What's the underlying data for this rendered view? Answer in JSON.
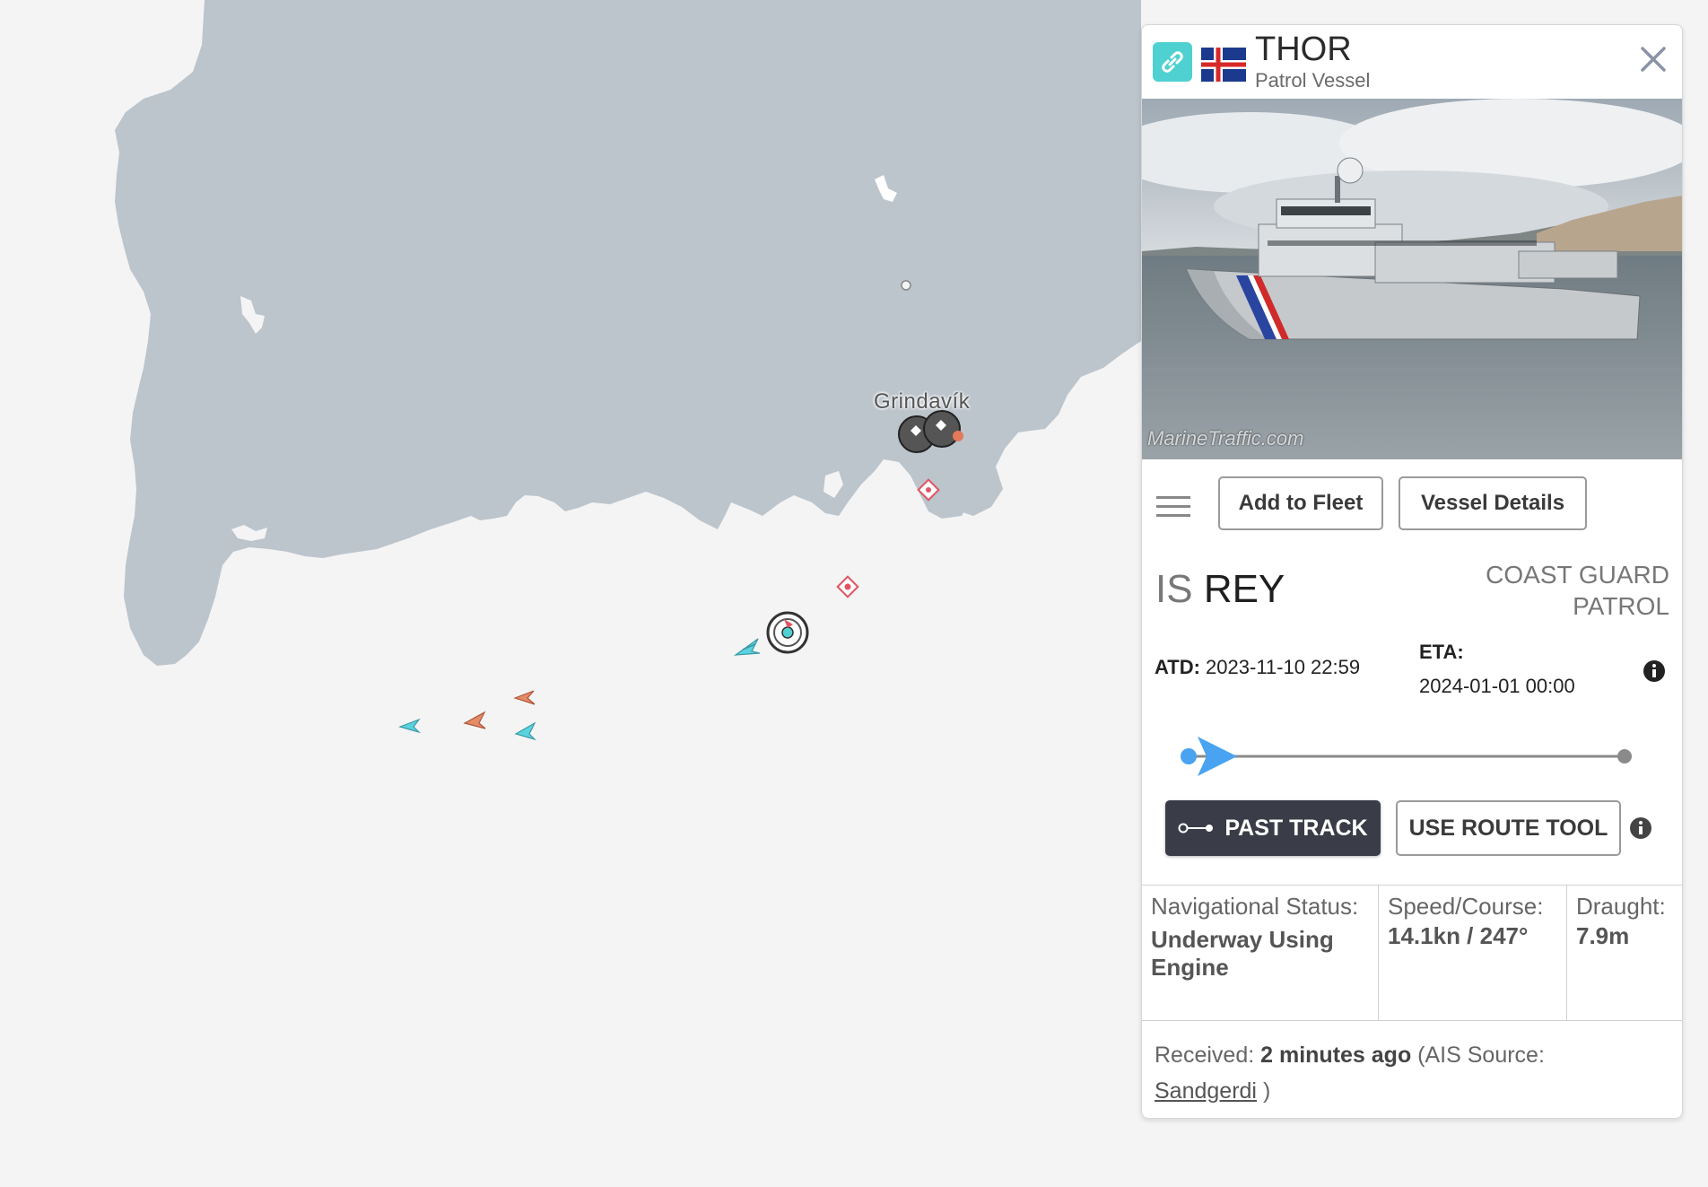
{
  "map": {
    "place_label": "Grindavík",
    "colors": {
      "land": "#bcc4cc",
      "sea": "#f4f4f4"
    }
  },
  "vessel": {
    "name": "THOR",
    "type": "Patrol Vessel",
    "flag_icon": "iceland-flag-icon",
    "photo_watermark": "MarineTraffic.com",
    "flag_code": "IS",
    "port": "REY",
    "category": "COAST GUARD PATROL",
    "atd_label": "ATD:",
    "atd_value": "2023-11-10 22:59",
    "eta_label": "ETA:",
    "eta_value": "2024-01-01 00:00",
    "voyage_progress": 0.0
  },
  "actions": {
    "add_to_fleet": "Add to Fleet",
    "vessel_details": "Vessel Details",
    "past_track": "PAST TRACK",
    "use_route_tool": "USE ROUTE TOOL"
  },
  "status": {
    "nav_status_label": "Navigational Status:",
    "nav_status_value": "Underway Using Engine",
    "speed_course_label": "Speed/Course:",
    "speed_course_value": "14.1kn / 247°",
    "draught_label": "Draught:",
    "draught_value": "7.9m"
  },
  "received": {
    "label": "Received:",
    "value": "2 minutes ago",
    "source_prefix": "(AIS Source:",
    "source_link": "Sandgerdi",
    "source_suffix": ")"
  },
  "colors": {
    "accent_teal": "#4fd0d1",
    "progress_blue": "#4aa3f0",
    "dark_button": "#3a3d47"
  }
}
